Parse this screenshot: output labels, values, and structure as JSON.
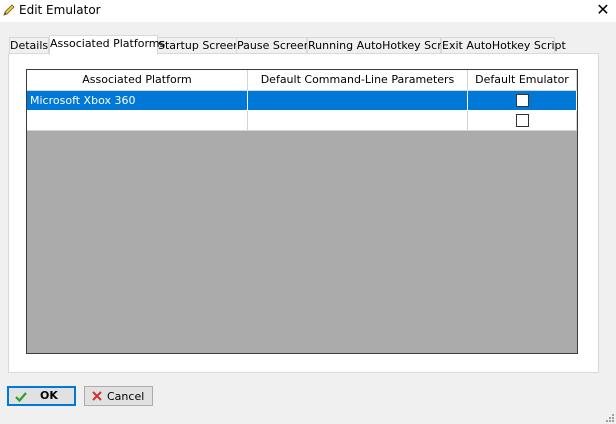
{
  "window": {
    "title": "Edit Emulator",
    "title_icon": "pencil-icon",
    "close_glyph": "✕"
  },
  "tabs": [
    {
      "label": "Details",
      "active": false
    },
    {
      "label": "Associated Platforms",
      "active": true
    },
    {
      "label": "Startup Screen",
      "active": false
    },
    {
      "label": "Pause Screen",
      "active": false
    },
    {
      "label": "Running AutoHotkey Script",
      "active": false
    },
    {
      "label": "Exit AutoHotkey Script",
      "active": false
    }
  ],
  "grid": {
    "columns": [
      "Associated Platform",
      "Default Command-Line Parameters",
      "Default Emulator"
    ],
    "rows": [
      {
        "platform": "Microsoft Xbox 360",
        "params": "",
        "default_emulator": false,
        "selected": true
      },
      {
        "platform": "",
        "params": "",
        "default_emulator": false,
        "selected": false
      }
    ]
  },
  "buttons": {
    "ok": {
      "label": "OK",
      "icon": "checkmark-icon"
    },
    "cancel": {
      "label": "Cancel",
      "icon": "x-icon"
    }
  },
  "colors": {
    "selection": "#0078d7",
    "grid_empty": "#ababab",
    "ok_check": "#2e9c2e",
    "cancel_x": "#d32f2f"
  }
}
